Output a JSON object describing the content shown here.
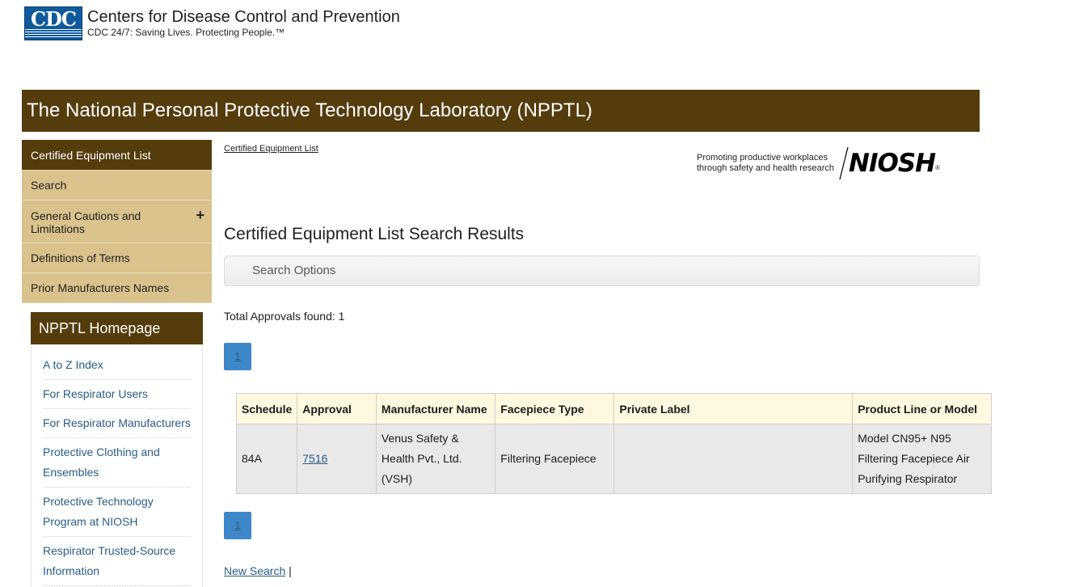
{
  "cdc": {
    "logo_text": "CDC",
    "title": "Centers for Disease Control and Prevention",
    "tagline": "CDC 24/7: Saving Lives. Protecting People.™"
  },
  "banner": {
    "title": "The National Personal Protective Technology Laboratory (NPPTL)"
  },
  "leftnav": {
    "items": [
      {
        "label": "Certified Equipment List"
      },
      {
        "label": "Search"
      },
      {
        "label": "General Cautions and Limitations",
        "expand_glyph": "+"
      },
      {
        "label": "Definitions of Terms"
      },
      {
        "label": "Prior Manufacturers Names"
      }
    ]
  },
  "subnav": {
    "heading": "NPPTL Homepage",
    "links": [
      {
        "label": "A to Z Index"
      },
      {
        "label": "For Respirator Users"
      },
      {
        "label": "For Respirator Manufacturers"
      },
      {
        "label": "Protective Clothing and Ensembles"
      },
      {
        "label": "Protective Technology Program at NIOSH"
      },
      {
        "label": "Respirator Trusted-Source Information"
      }
    ]
  },
  "breadcrumb": {
    "label": "Certified Equipment List"
  },
  "niosh": {
    "tag_line1": "Promoting productive workplaces",
    "tag_line2": "through safety and health research",
    "wordmark": "NIOSH",
    "registered": "®"
  },
  "main": {
    "title": "Certified Equipment List Search Results",
    "search_options": "Search Options",
    "total": "Total Approvals found: 1",
    "page_number": "1"
  },
  "table": {
    "headers": {
      "schedule": "Schedule",
      "approval": "Approval",
      "manufacturer": "Manufacturer Name",
      "facepiece": "Facepiece Type",
      "private_label": "Private Label",
      "product": "Product Line or Model"
    },
    "rows": [
      {
        "schedule": "84A",
        "approval": "7516",
        "manufacturer": "Venus Safety & Health Pvt., Ltd. (VSH)",
        "facepiece": "Filtering Facepiece",
        "private_label": "",
        "product": "Model CN95+ N95 Filtering Facepiece Air Purifying Respirator"
      }
    ]
  },
  "footer": {
    "new_search": "New Search",
    "separator": "|"
  }
}
